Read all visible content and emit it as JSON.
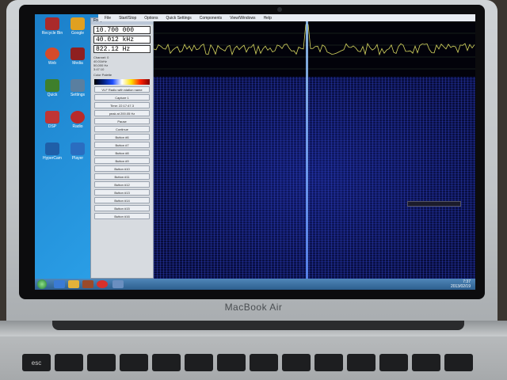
{
  "device": {
    "brand": "MacBook Air"
  },
  "app": {
    "menu": [
      "File",
      "Start/Stop",
      "Options",
      "Quick Settings",
      "Components",
      "View/Windows",
      "Help"
    ],
    "tab_labels": [
      "Freq",
      "Demo",
      "Mrkr"
    ],
    "frequencies": [
      "10.700 000",
      "40.012 kHz",
      "822.12 Hz"
    ],
    "info_lines": [
      "Channel: 0",
      "40.01kHz",
      "50,000 Hz",
      "3:47:10"
    ],
    "palette_label": "Color Palette",
    "buttons": [
      "VLF Radio with station name",
      "Capture 1",
      "Time: 22:17:47.3",
      "peak at 200.05 Hz",
      "Pause",
      "Continue",
      "Button #6",
      "Button #7",
      "Button #8",
      "Button #9",
      "Button #10",
      "Button #11",
      "Button #12",
      "Button #13",
      "Button #14",
      "Button #15",
      "Button #16"
    ]
  },
  "desktop_icons": [
    "Recycle Bin",
    "Google",
    "Web",
    "Media",
    "Quick",
    "Settings",
    "DSP",
    "Radio",
    "HyperCam",
    "Player"
  ],
  "taskbar": {
    "time": "7:37",
    "date": "2013/02/19"
  }
}
